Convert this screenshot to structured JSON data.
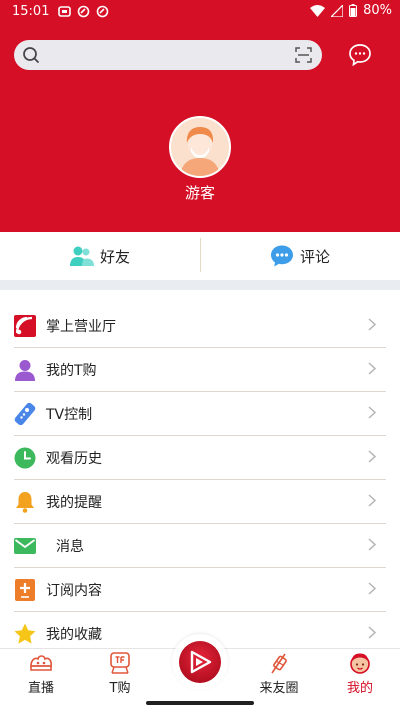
{
  "status_bar": {
    "time": "15:01",
    "battery": "80%"
  },
  "search": {
    "placeholder": "",
    "icon": "search-icon",
    "scan_icon": "scan-icon"
  },
  "header": {
    "message_icon": "chat-bubble-icon",
    "username": "游客",
    "bg_color": "#d50f25"
  },
  "quick_tabs": [
    {
      "label": "好友",
      "icon": "friends-icon"
    },
    {
      "label": "评论",
      "icon": "comment-icon"
    }
  ],
  "menu": [
    {
      "label": "掌上营业厅",
      "icon": "signal-hall-icon"
    },
    {
      "label": "我的T购",
      "icon": "user-icon"
    },
    {
      "label": "TV控制",
      "icon": "remote-icon"
    },
    {
      "label": "观看历史",
      "icon": "clock-icon"
    },
    {
      "label": "我的提醒",
      "icon": "bell-icon"
    },
    {
      "label": "消息",
      "icon": "mail-icon"
    },
    {
      "label": "订阅内容",
      "icon": "subscribe-icon"
    },
    {
      "label": "我的收藏",
      "icon": "star-icon"
    }
  ],
  "tabbar": {
    "items": [
      {
        "label": "直播",
        "icon": "live-icon"
      },
      {
        "label": "T购",
        "icon": "tshop-icon"
      },
      {
        "label": "来友圈",
        "icon": "circle-icon"
      },
      {
        "label": "我的",
        "icon": "profile-icon",
        "active": true
      }
    ],
    "center_icon": "play-center-icon",
    "active_color": "#d50f25"
  }
}
